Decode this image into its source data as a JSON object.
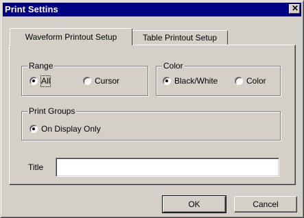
{
  "window": {
    "title": "Print Settins",
    "close_glyph": "✕"
  },
  "tabs": [
    {
      "label": "Waveform Printout Setup",
      "selected": true
    },
    {
      "label": "Table Printout Setup",
      "selected": false
    }
  ],
  "range": {
    "legend": "Range",
    "options": [
      {
        "label": "All",
        "checked": true
      },
      {
        "label": "Cursor",
        "checked": false
      }
    ]
  },
  "color": {
    "legend": "Color",
    "options": [
      {
        "label": "Black/White",
        "checked": true
      },
      {
        "label": "Color",
        "checked": false
      }
    ]
  },
  "print_groups": {
    "legend": "Print Groups",
    "options": [
      {
        "label": "On Display Only",
        "checked": true
      }
    ]
  },
  "title_field": {
    "label": "Title",
    "value": ""
  },
  "buttons": {
    "ok": "OK",
    "cancel": "Cancel"
  },
  "colors": {
    "face": "#d4d0c8",
    "titlebar": "#000080",
    "title_text": "#ffffff"
  }
}
